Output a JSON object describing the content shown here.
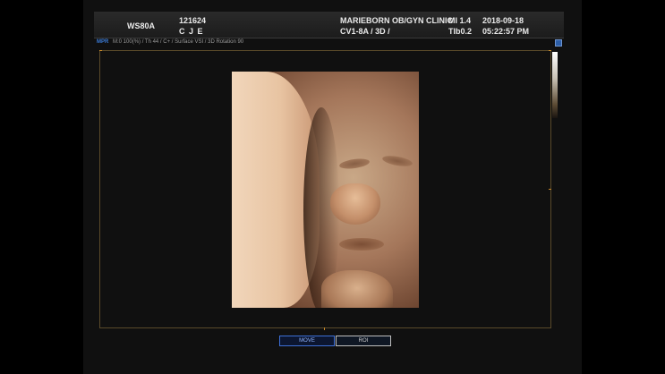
{
  "header": {
    "model": "WS80A",
    "patient_id": "121624",
    "patient_name": "C J E",
    "clinic": "MARIEBORN OB/GYN CLINIC",
    "probe_mode": "CV1-8A / 3D /",
    "mi": "MI  1.4",
    "tib": "TIb0.2",
    "date": "2018-09-18",
    "time": "05:22:57 PM"
  },
  "infobar": {
    "mode": "MPR",
    "params": "M:0 100(%) / Th 44 / C+ / Surface VSI / 3D Rotation 90"
  },
  "buttons": {
    "move": "MOVE",
    "roi": "ROI"
  },
  "colors": {
    "active_button": "#3d6fd6",
    "frame_tick": "#c98a2b"
  }
}
